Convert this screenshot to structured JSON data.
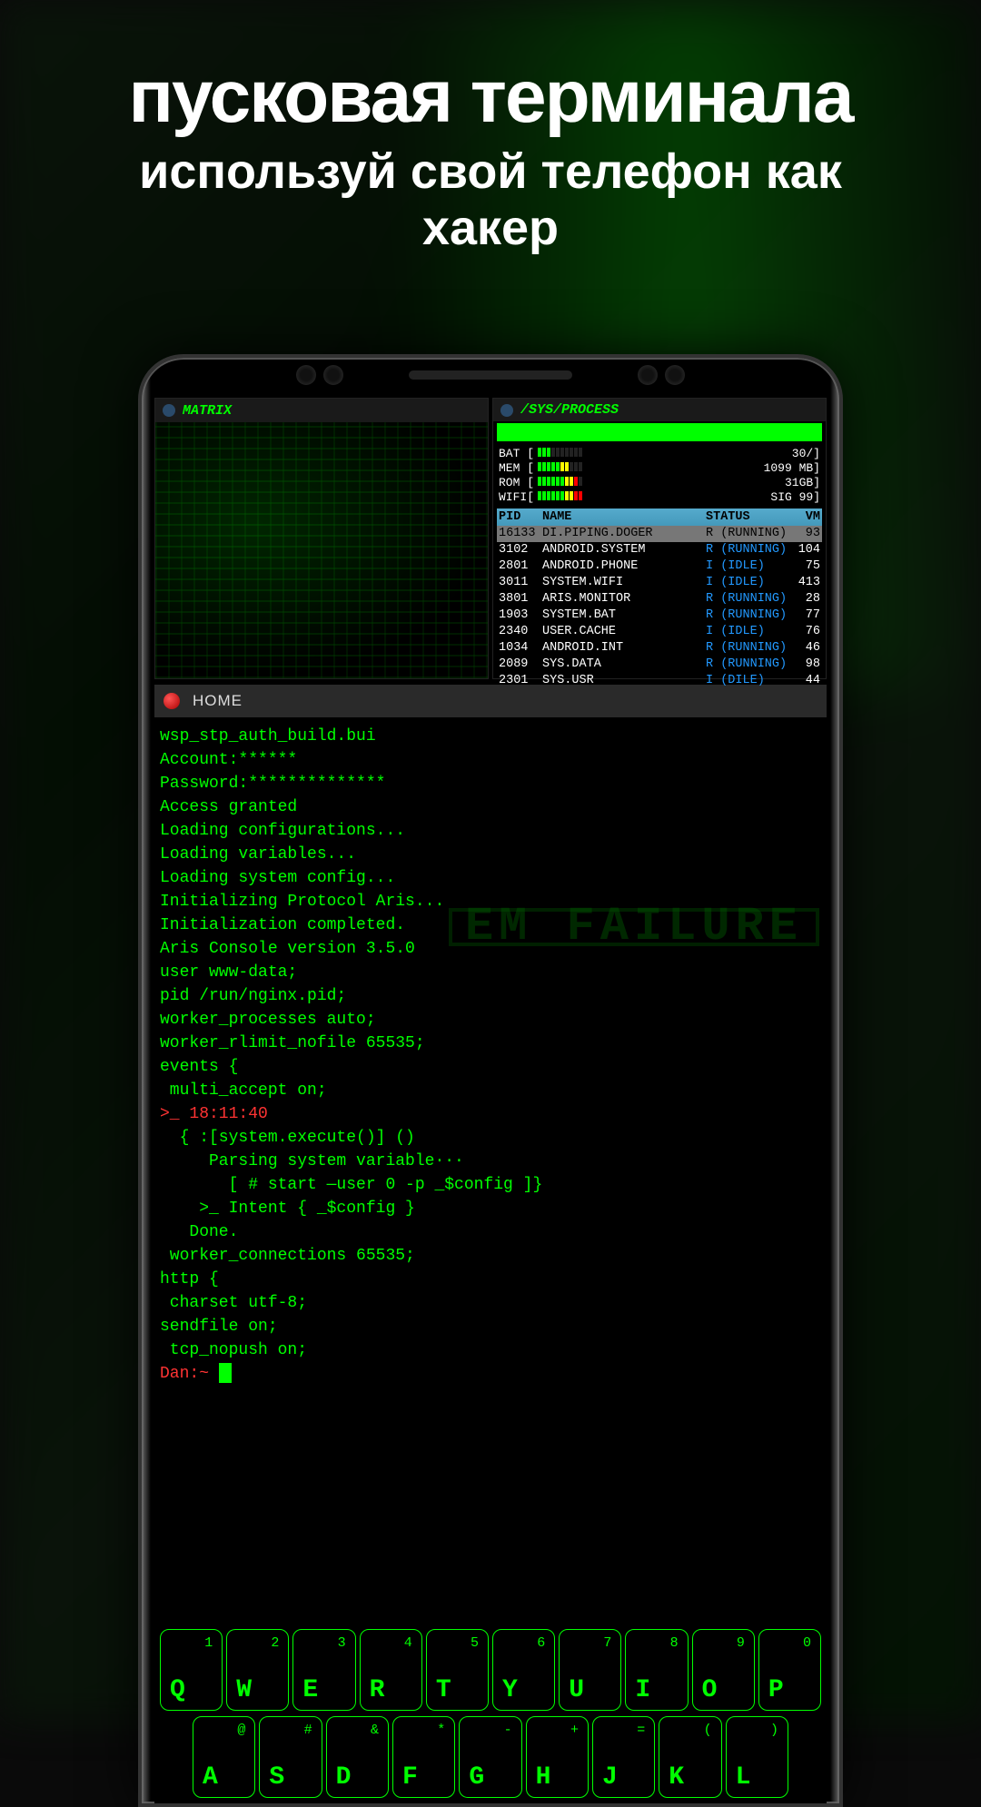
{
  "hero": {
    "title": "пусковая терминала",
    "subtitle1": "используй свой телефон как",
    "subtitle2": "хакер"
  },
  "panels": {
    "matrix_title": "MATRIX",
    "sys_title": "/SYS/PROCESS"
  },
  "stats": {
    "bat": {
      "label": "BAT [",
      "val": "30/]"
    },
    "mem": {
      "label": "MEM [",
      "val": "1099 MB]"
    },
    "rom": {
      "label": "ROM [",
      "val": "31GB]"
    },
    "wifi": {
      "label": "WIFI[",
      "val": "SIG 99]"
    }
  },
  "proc_header": {
    "pid": "PID",
    "name": "NAME",
    "status": "STATUS",
    "vm": "VM"
  },
  "processes": [
    {
      "pid": "16133",
      "name": "DI.PIPING.DOGER",
      "status": "R (RUNNING)",
      "vm": "93",
      "sel": true
    },
    {
      "pid": "3102",
      "name": "ANDROID.SYSTEM",
      "status": "R (RUNNING)",
      "vm": "104",
      "sel": false
    },
    {
      "pid": "2801",
      "name": "ANDROID.PHONE",
      "status": "I (IDLE)",
      "vm": "75",
      "sel": false
    },
    {
      "pid": "3011",
      "name": "SYSTEM.WIFI",
      "status": "I (IDLE)",
      "vm": "413",
      "sel": false
    },
    {
      "pid": "3801",
      "name": "ARIS.MONITOR",
      "status": "R (RUNNING)",
      "vm": "28",
      "sel": false
    },
    {
      "pid": "1903",
      "name": "SYSTEM.BAT",
      "status": "R (RUNNING)",
      "vm": "77",
      "sel": false
    },
    {
      "pid": "2340",
      "name": "USER.CACHE",
      "status": "I (IDLE)",
      "vm": "76",
      "sel": false
    },
    {
      "pid": "1034",
      "name": "ANDROID.INT",
      "status": "R (RUNNING)",
      "vm": "46",
      "sel": false
    },
    {
      "pid": "2089",
      "name": "SYS.DATA",
      "status": "R (RUNNING)",
      "vm": "98",
      "sel": false
    },
    {
      "pid": "2301",
      "name": "SYS.USR",
      "status": "I (DILE)",
      "vm": "44",
      "sel": false
    }
  ],
  "console": {
    "tab": "HOME",
    "lines": [
      "wsp_stp_auth_build.bui",
      "Account:******",
      "Password:**************",
      "Access granted",
      "Loading configurations...",
      "Loading variables...",
      "Loading system config...",
      "Initializing Protocol Aris...",
      "Initialization completed.",
      "Aris Console version 3.5.0",
      "user www-data;",
      "pid /run/nginx.pid;",
      "worker_processes auto;",
      "worker_rlimit_nofile 65535;",
      "",
      "events {",
      " multi_accept on;"
    ],
    "line_red1": ">_ 18:11:40",
    "lines2": [
      "  { :[system.execute()] ()",
      "     Parsing system variable···",
      "       [ # start —user 0 -p _$config ]}",
      "    >_ Intent { _$config }",
      "   Done.",
      " worker_connections 65535;",
      "",
      "http {",
      " charset utf-8;",
      "sendfile on;",
      " tcp_nopush on;"
    ],
    "prompt": "Dan:~",
    "failure": "EM FAILURE"
  },
  "keyboard": {
    "row1": [
      {
        "main": "Q",
        "sup": "1"
      },
      {
        "main": "W",
        "sup": "2"
      },
      {
        "main": "E",
        "sup": "3"
      },
      {
        "main": "R",
        "sup": "4"
      },
      {
        "main": "T",
        "sup": "5"
      },
      {
        "main": "Y",
        "sup": "6"
      },
      {
        "main": "U",
        "sup": "7"
      },
      {
        "main": "I",
        "sup": "8"
      },
      {
        "main": "O",
        "sup": "9"
      },
      {
        "main": "P",
        "sup": "0"
      }
    ],
    "row2": [
      {
        "main": "A",
        "sup": "@"
      },
      {
        "main": "S",
        "sup": "#"
      },
      {
        "main": "D",
        "sup": "&"
      },
      {
        "main": "F",
        "sup": "*"
      },
      {
        "main": "G",
        "sup": "-"
      },
      {
        "main": "H",
        "sup": "+"
      },
      {
        "main": "J",
        "sup": "="
      },
      {
        "main": "K",
        "sup": "("
      },
      {
        "main": "L",
        "sup": ")"
      }
    ]
  }
}
